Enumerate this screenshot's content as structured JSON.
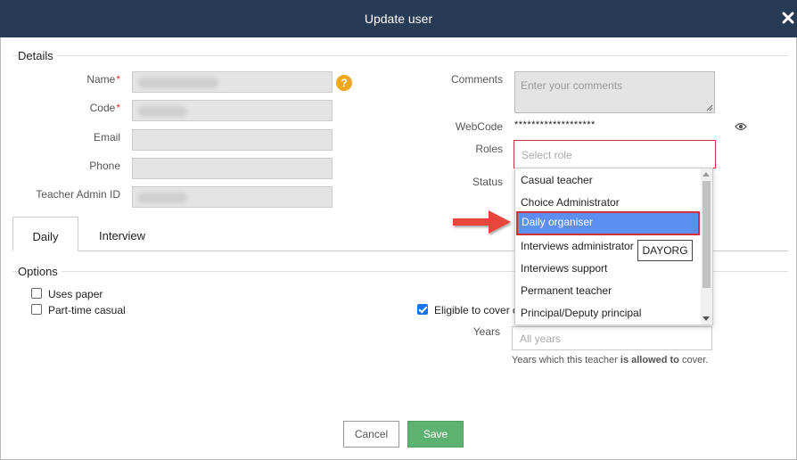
{
  "modal": {
    "title": "Update user"
  },
  "details": {
    "legend": "Details",
    "name_label": "Name",
    "code_label": "Code",
    "email_label": "Email",
    "phone_label": "Phone",
    "admin_id_label": "Teacher Admin ID",
    "required_mark": "*",
    "help_glyph": "?",
    "comments_label": "Comments",
    "comments_placeholder": "Enter your comments",
    "webcode_label": "WebCode",
    "webcode_value": "*******************",
    "roles_label": "Roles",
    "roles_placeholder": "Select role",
    "status_label": "Status"
  },
  "roles_dropdown": {
    "items": [
      "Casual teacher",
      "Choice Administrator",
      "Daily organiser",
      "Interviews administrator",
      "Interviews support",
      "Permanent teacher",
      "Principal/Deputy principal"
    ],
    "highlighted": "Daily organiser",
    "tooltip": "DAYORG"
  },
  "tabs": [
    "Daily",
    "Interview"
  ],
  "options": {
    "legend": "Options",
    "uses_paper": {
      "label": "Uses paper",
      "checked": false
    },
    "part_time_casual": {
      "label": "Part-time casual",
      "checked": false
    },
    "eligible": {
      "label": "Eligible to cover c",
      "checked": true
    },
    "years_label": "Years",
    "years_placeholder": "All years",
    "years_help_pre": "Years which this teacher ",
    "years_help_bold": "is allowed to",
    "years_help_post": " cover."
  },
  "buttons": {
    "cancel": "Cancel",
    "save": "Save"
  },
  "colors": {
    "header": "#273b54",
    "save": "#5cb270",
    "highlight": "#5b8ff2",
    "annotation_red": "#d0313d",
    "help": "#f0a81e"
  }
}
